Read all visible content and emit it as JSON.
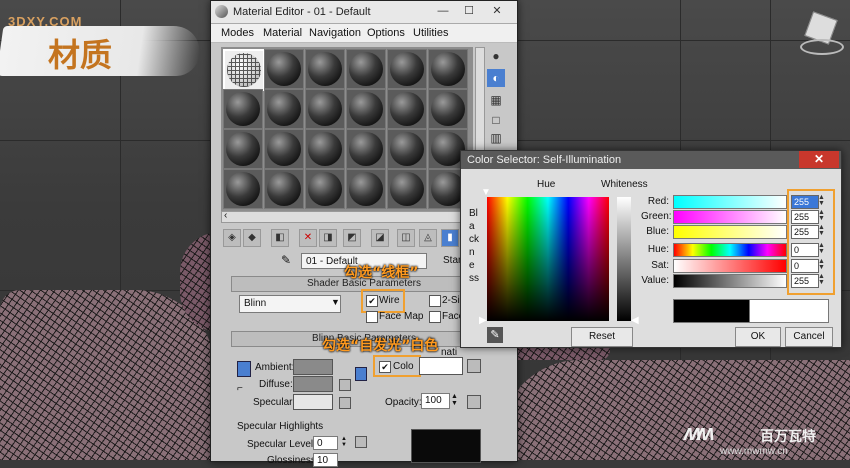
{
  "overlay": {
    "brand_watermark": "3DXY.COM",
    "page_title": "材质",
    "annotation_wire": "勾选“线框”",
    "annotation_self_illum": "勾选“自发光”白色",
    "site_watermark": "www.mwmw.cn",
    "footer_logo": "百万瓦特"
  },
  "material_editor": {
    "title": "Material Editor - 01 - Default",
    "menu": [
      "Modes",
      "Material",
      "Navigation",
      "Options",
      "Utilities"
    ],
    "material_name": "01 - Default",
    "type_button": "Star",
    "shader_rollout": "Shader Basic Parameters",
    "shader_type": "Blinn",
    "wire_label": "Wire",
    "wire_checked": true,
    "two_sided_label": "2-Sid",
    "face_map_label": "Face Map",
    "faceted_label": "Face",
    "blinn_rollout": "Blinn Basic Parameters",
    "illumination_partial": "nati",
    "ambient_label": "Ambient:",
    "diffuse_label": "Diffuse:",
    "specular_label": "Specular:",
    "color_label": "Colo",
    "color_checked": true,
    "opacity_label": "Opacity:",
    "opacity_value": "100",
    "specular_highlights_label": "Specular Highlights",
    "specular_level_label": "Specular Level:",
    "specular_level_value": "0",
    "glossiness_label": "Glossiness:",
    "glossiness_value": "10"
  },
  "color_selector": {
    "title": "Color Selector: Self-Illumination",
    "hue_label": "Hue",
    "whiteness_label": "Whiteness",
    "blackness_label": "Blackness",
    "red_label": "Red:",
    "red_value": "255",
    "green_label": "Green:",
    "green_value": "255",
    "blue_label": "Blue:",
    "blue_value": "255",
    "hue_field_label": "Hue:",
    "hue_value": "0",
    "sat_label": "Sat:",
    "sat_value": "0",
    "value_label": "Value:",
    "value_value": "255",
    "reset_button": "Reset",
    "ok_button": "OK",
    "cancel_button": "Cancel"
  },
  "colors": {
    "annotation": "#ff9a1f",
    "highlight_box": "#f0a030",
    "close_button": "#c8372c"
  }
}
